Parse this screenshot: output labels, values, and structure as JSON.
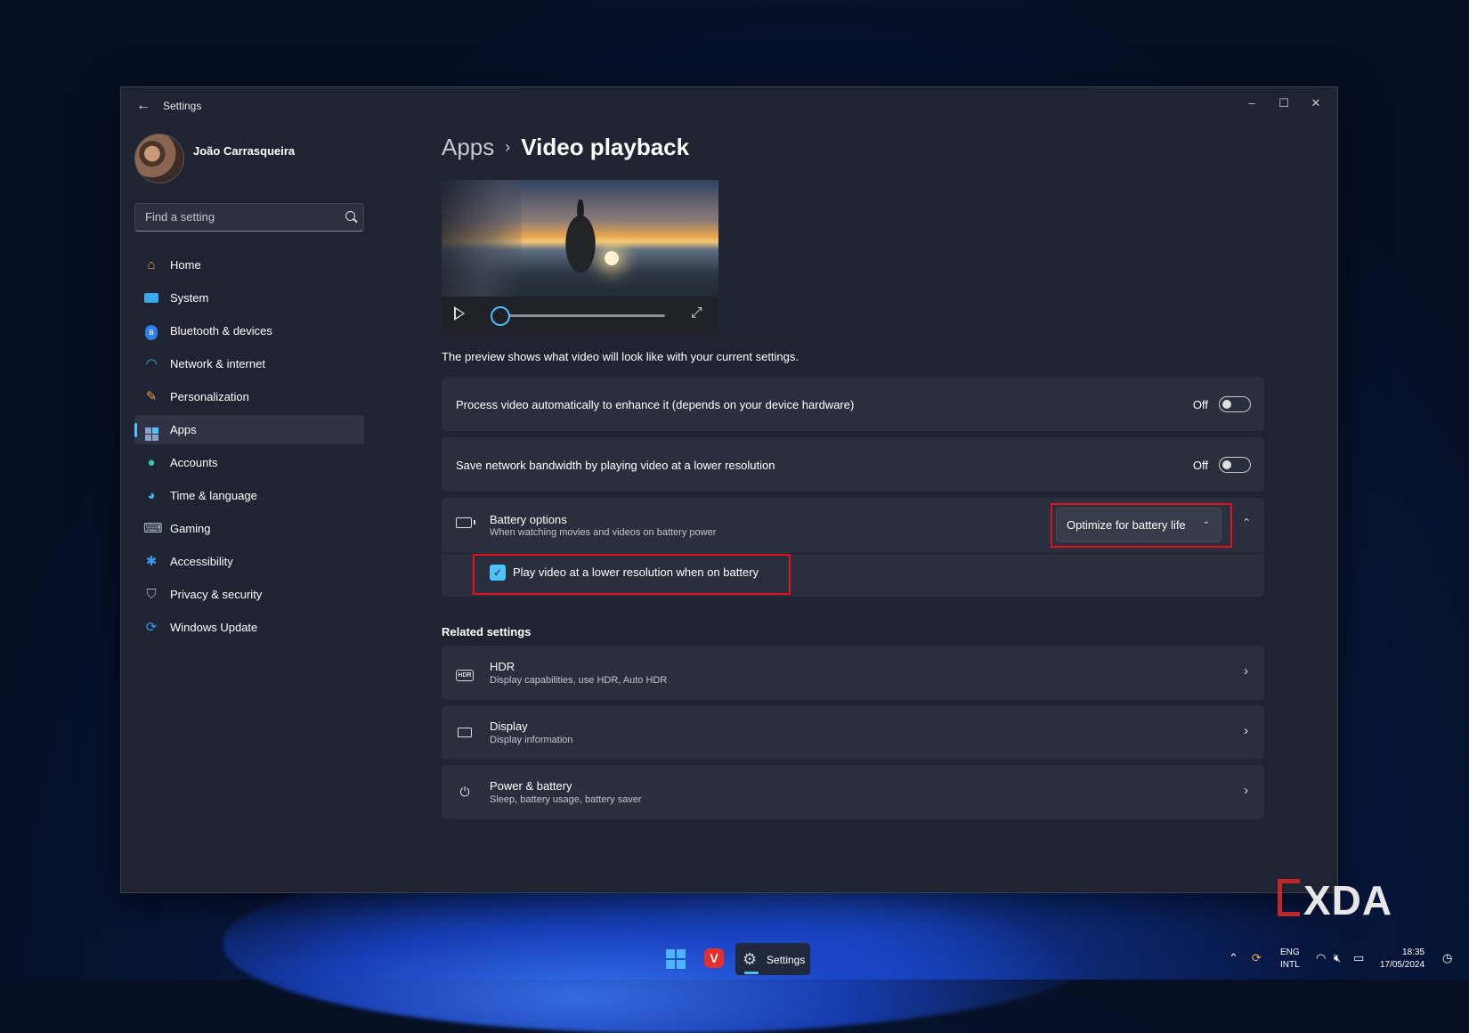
{
  "window": {
    "title": "Settings",
    "minimize": "–",
    "maximize": "☐",
    "close": "✕"
  },
  "profile": {
    "name": "João Carrasqueira"
  },
  "search": {
    "placeholder": "Find a setting"
  },
  "nav": {
    "items": [
      {
        "label": "Home",
        "icon": "home-icon"
      },
      {
        "label": "System",
        "icon": "system-icon"
      },
      {
        "label": "Bluetooth & devices",
        "icon": "bluetooth-icon"
      },
      {
        "label": "Network & internet",
        "icon": "wifi-icon"
      },
      {
        "label": "Personalization",
        "icon": "brush-icon"
      },
      {
        "label": "Apps",
        "icon": "apps-icon",
        "selected": true
      },
      {
        "label": "Accounts",
        "icon": "account-icon"
      },
      {
        "label": "Time & language",
        "icon": "globe-clock-icon"
      },
      {
        "label": "Gaming",
        "icon": "gamepad-icon"
      },
      {
        "label": "Accessibility",
        "icon": "accessibility-icon"
      },
      {
        "label": "Privacy & security",
        "icon": "shield-icon"
      },
      {
        "label": "Windows Update",
        "icon": "update-icon"
      }
    ]
  },
  "breadcrumb": {
    "parent": "Apps",
    "separator": "›",
    "current": "Video playback"
  },
  "preview": {
    "caption": "The preview shows what video will look like with your current settings.",
    "progress": 0
  },
  "settings": {
    "process_video": {
      "label": "Process video automatically to enhance it (depends on your device hardware)",
      "state": "Off"
    },
    "save_bandwidth": {
      "label": "Save network bandwidth by playing video at a lower resolution",
      "state": "Off"
    },
    "battery": {
      "title": "Battery options",
      "subtitle": "When watching movies and videos on battery power",
      "dropdown_value": "Optimize for battery life",
      "checkbox_label": "Play video at a lower resolution when on battery",
      "checkbox_checked": true
    }
  },
  "related": {
    "heading": "Related settings",
    "items": [
      {
        "title": "HDR",
        "subtitle": "Display capabilities, use HDR, Auto HDR",
        "icon": "hdr-icon",
        "badge": "HDR"
      },
      {
        "title": "Display",
        "subtitle": "Display information",
        "icon": "display-icon"
      },
      {
        "title": "Power & battery",
        "subtitle": "Sleep, battery usage, battery saver",
        "icon": "power-icon"
      }
    ]
  },
  "taskbar": {
    "settings_label": "Settings",
    "lang_top": "ENG",
    "lang_bottom": "INTL",
    "time": "18:35",
    "date": "17/05/2024"
  },
  "watermark": {
    "text": "XDA"
  },
  "colors": {
    "accent": "#4cc2ff",
    "highlight": "#e3101c",
    "card": "#2a2f3d",
    "window": "#1f2432"
  }
}
